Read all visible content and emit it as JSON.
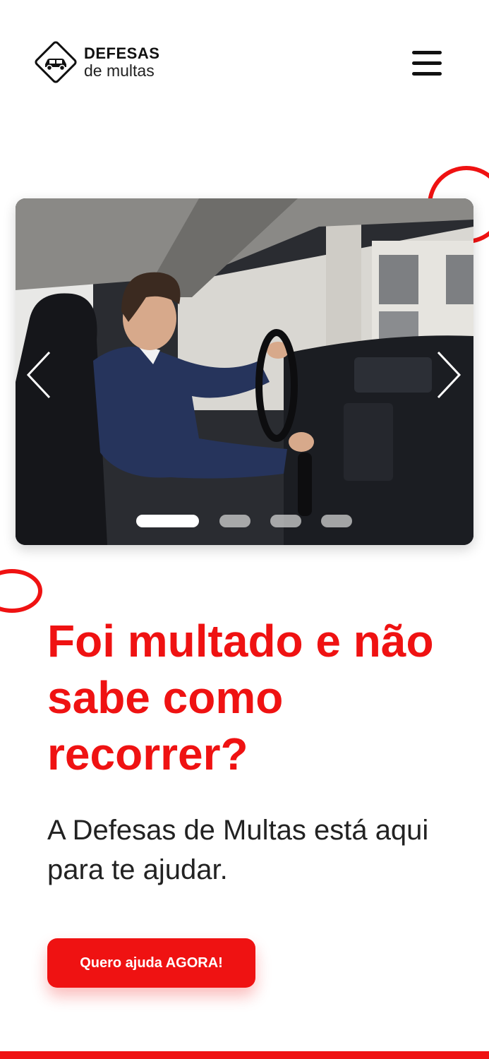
{
  "brand": {
    "title": "DEFESAS",
    "subtitle": "de multas"
  },
  "menu": {
    "icon": "hamburger-menu-icon"
  },
  "carousel": {
    "slide_count": 4,
    "active_index": 0,
    "prev_icon": "chevron-left-icon",
    "next_icon": "chevron-right-icon"
  },
  "hero": {
    "headline": "Foi multado e não sabe como recorrer?",
    "subhead": "A Defesas de Multas está aqui para te ajudar.",
    "cta_label": "Quero ajuda AGORA!"
  },
  "colors": {
    "accent": "#ef1212",
    "text": "#222222"
  }
}
